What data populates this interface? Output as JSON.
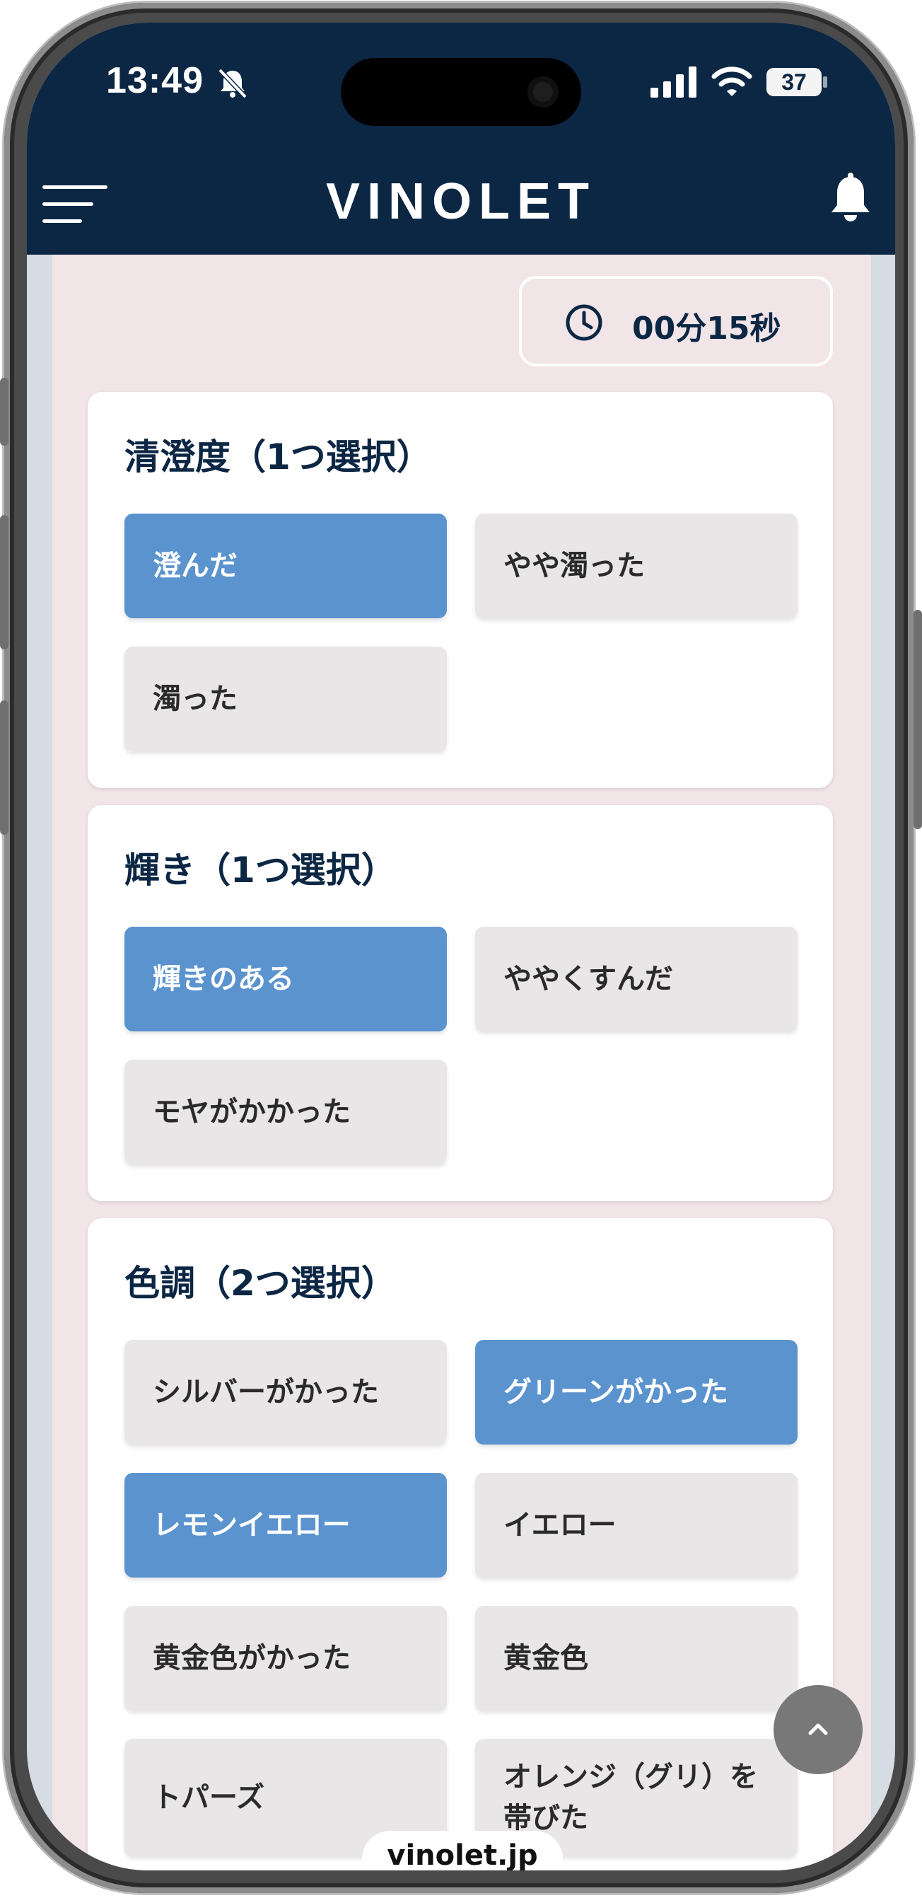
{
  "status_bar": {
    "time": "13:49",
    "battery": "37"
  },
  "header": {
    "logo": "VINOLET"
  },
  "timer": {
    "text": "00分15秒"
  },
  "sections": [
    {
      "title": "清澄度（1つ選択）",
      "options": [
        {
          "label": "澄んだ",
          "selected": true
        },
        {
          "label": "やや濁った",
          "selected": false
        },
        {
          "label": "濁った",
          "selected": false
        }
      ]
    },
    {
      "title": "輝き（1つ選択）",
      "options": [
        {
          "label": "輝きのある",
          "selected": true
        },
        {
          "label": "ややくすんだ",
          "selected": false
        },
        {
          "label": "モヤがかかった",
          "selected": false
        }
      ]
    },
    {
      "title": "色調（2つ選択）",
      "options": [
        {
          "label": "シルバーがかった",
          "selected": false
        },
        {
          "label": "グリーンがかった",
          "selected": true
        },
        {
          "label": "レモンイエロー",
          "selected": true
        },
        {
          "label": "イエロー",
          "selected": false
        },
        {
          "label": "黄金色がかった",
          "selected": false
        },
        {
          "label": "黄金色",
          "selected": false
        },
        {
          "label": "トパーズ",
          "selected": false
        },
        {
          "label": "オレンジ（グリ）を帯びた",
          "selected": false
        }
      ]
    }
  ],
  "footer": {
    "domain": "vinolet.jp"
  },
  "colors": {
    "header": "#0c2744",
    "selected": "#5b93cf",
    "unselected": "#e8e6e6",
    "background": "#f1e5e8"
  }
}
